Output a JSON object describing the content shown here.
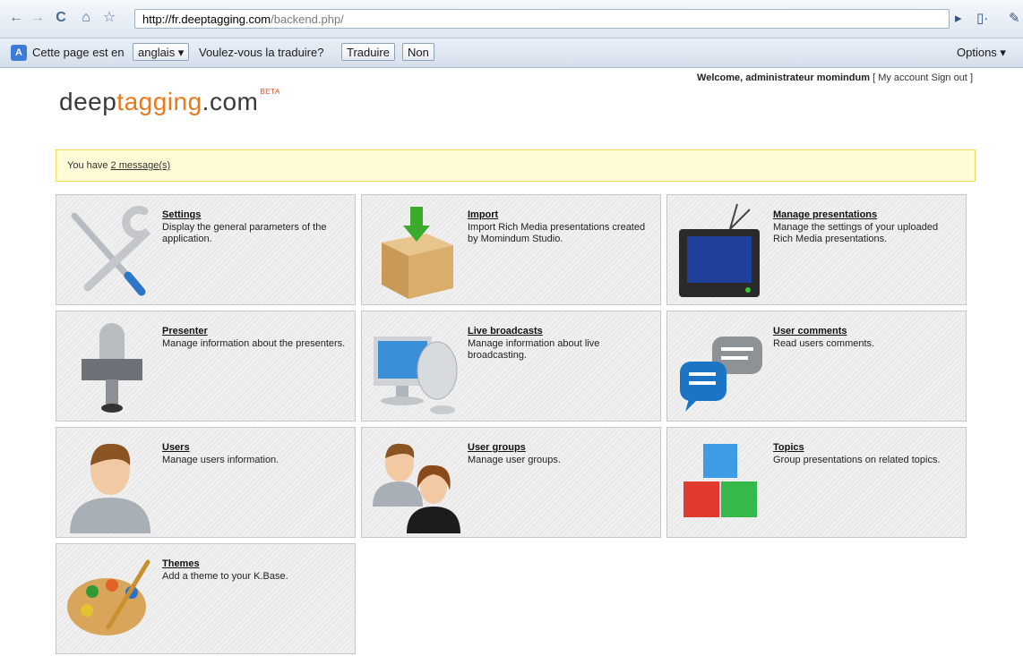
{
  "browser": {
    "url_domain": "http://fr.deeptagging.com",
    "url_path": "/backend.php/"
  },
  "translate_bar": {
    "text1": "Cette page est en",
    "language": "anglais ▾",
    "text2": "Voulez-vous la traduire?",
    "translate_btn": "Traduire",
    "no_btn": "Non",
    "options": "Options ▾"
  },
  "header": {
    "welcome": "Welcome, administrateur momindum",
    "bracket_open": "[",
    "my_account": "My account",
    "sign_out": "Sign out",
    "bracket_close": "]",
    "logo_a": "deep",
    "logo_b": "tagging",
    "logo_c": ".com",
    "logo_beta": "BETA"
  },
  "notice": {
    "prefix": "You have",
    "link": "2 message(s)"
  },
  "tiles": [
    {
      "title": "Settings",
      "desc": "Display the general parameters of the application."
    },
    {
      "title": "Import",
      "desc": "Import Rich Media presentations created by Momindum Studio."
    },
    {
      "title": "Manage presentations",
      "desc": "Manage the settings of your uploaded Rich Media presentations."
    },
    {
      "title": "Presenter",
      "desc": "Manage information about the presenters."
    },
    {
      "title": "Live broadcasts",
      "desc": "Manage information about live broadcasting."
    },
    {
      "title": "User comments",
      "desc": "Read users comments."
    },
    {
      "title": "Users",
      "desc": "Manage users information."
    },
    {
      "title": "User groups",
      "desc": "Manage user groups."
    },
    {
      "title": "Topics",
      "desc": "Group presentations on related topics."
    },
    {
      "title": "Themes",
      "desc": "Add a theme to your K.Base."
    }
  ]
}
